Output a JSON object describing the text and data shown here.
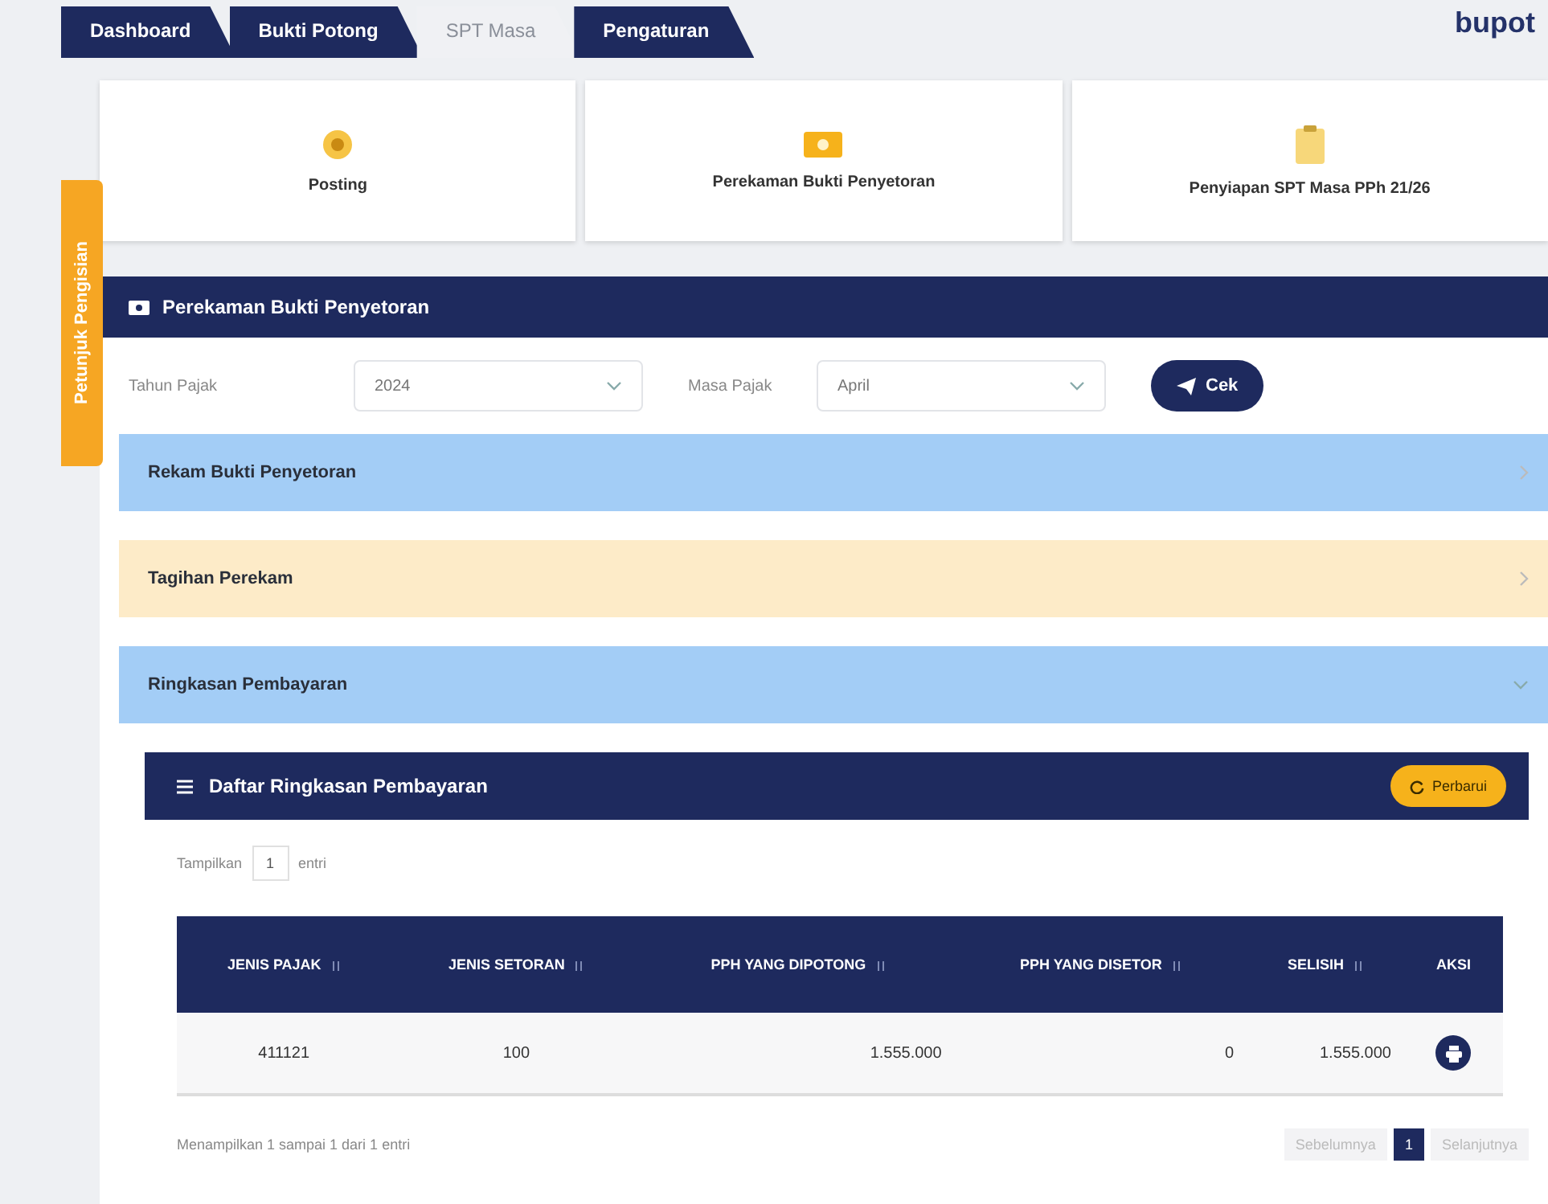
{
  "tabs": [
    {
      "label": "Dashboard",
      "selected": false
    },
    {
      "label": "Bukti Potong",
      "selected": false
    },
    {
      "label": "SPT Masa",
      "selected": true
    },
    {
      "label": "Pengaturan",
      "selected": false
    }
  ],
  "logo": "bupot",
  "side_tab": {
    "label": "Petunjuk Pengisian"
  },
  "menu_cards": [
    {
      "label": "Posting",
      "kind": "coin"
    },
    {
      "label": "Perekaman Bukti Penyetoran",
      "kind": "money"
    },
    {
      "label": "Penyiapan SPT Masa PPh 21/26",
      "kind": "clipboard"
    }
  ],
  "section": {
    "title": "Perekaman Bukti Penyetoran"
  },
  "form": {
    "tahun_label": "Tahun Pajak",
    "tahun_value": "2024",
    "masa_label": "Masa Pajak",
    "masa_value": "April",
    "button": "Cek"
  },
  "accordions": [
    {
      "title": "Rekam Bukti Penyetoran",
      "color": "#a3cdf6",
      "expanded": false
    },
    {
      "title": "Tagihan Perekam",
      "color": "#fdebc8",
      "expanded": false
    },
    {
      "title": "Ringkasan Pembayaran",
      "color": "#a3cdf6",
      "expanded": true
    }
  ],
  "panel": {
    "title": "Daftar Ringkasan Pembayaran",
    "refresh_button": "Perbarui",
    "show_label": "Tampilkan",
    "show_value": "1",
    "show_suffix": "entri",
    "columns": [
      "JENIS PAJAK",
      "JENIS SETORAN",
      "PPH YANG DIPOTONG",
      "PPH YANG DISETOR",
      "SELISIH",
      "AKSI"
    ],
    "rows": [
      {
        "cells": [
          "411121",
          "100",
          "1.555.000",
          "0",
          "1.555.000"
        ]
      }
    ],
    "info": "Menampilkan 1 sampai 1 dari 1 entri",
    "pagination": [
      {
        "label": "Sebelumnya",
        "selected": false,
        "disabled": true
      },
      {
        "label": "1",
        "selected": true,
        "disabled": false
      },
      {
        "label": "Selanjutnya",
        "selected": false,
        "disabled": true
      }
    ]
  }
}
